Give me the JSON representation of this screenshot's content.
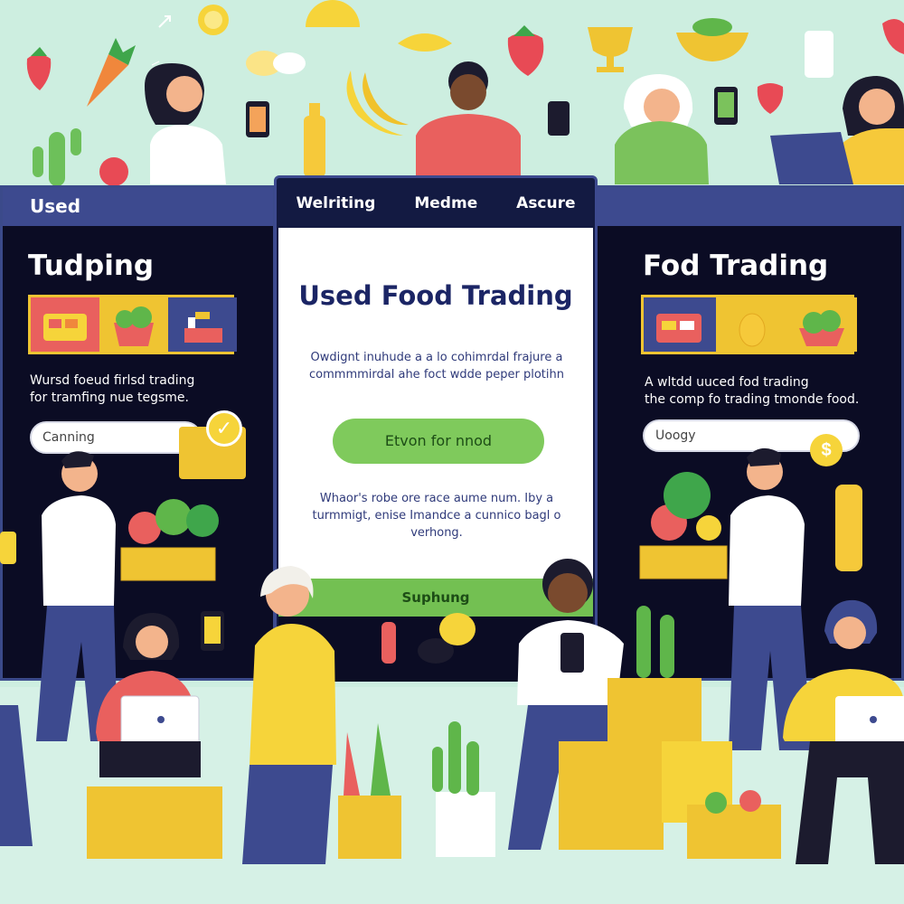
{
  "left_panel": {
    "bar_label": "Used",
    "title": "Tudping",
    "description_line1": "Wursd foeud firlsd trading",
    "description_line2": "for tramfing nue tegsme.",
    "search_value": "Canning"
  },
  "center_panel": {
    "tabs": [
      "Welriting",
      "Medme",
      "Ascure"
    ],
    "title": "Used Food Trading",
    "intro_line1": "Owdignt inuhude a a lo cohimrdal frajure a",
    "intro_line2": "commmmirdal ahe foct wdde peper plotihn",
    "cta_label": "Etvon for nnod",
    "note_line1": "Whaor's robe ore race aume num. Iby a",
    "note_line2": "turmmigt, enise Imandce a cunnico bagl o",
    "note_line3": "verhong.",
    "footer_label": "Suphung"
  },
  "right_panel": {
    "title": "Fod Trading",
    "description_line1": "A wltdd uuced fod trading",
    "description_line2": "the comp fo trading tmonde food.",
    "search_value": "Uoogy"
  },
  "colors": {
    "background": "#cdeee0",
    "panel_dark": "#0b0c24",
    "panel_bar": "#3d4a8f",
    "accent_green": "#7fca5c",
    "accent_yellow": "#efc432",
    "title_navy": "#1b2565"
  }
}
